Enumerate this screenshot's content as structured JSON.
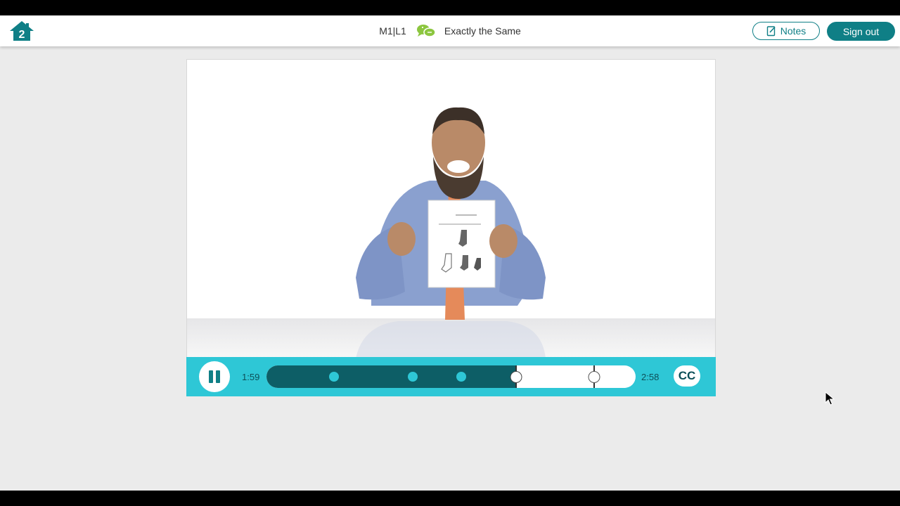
{
  "header": {
    "lesson_code": "M1|L1",
    "lesson_title": "Exactly the Same",
    "home_icon_text": "2",
    "notes_label": "Notes",
    "signout_label": "Sign out"
  },
  "player": {
    "current_time": "1:59",
    "total_time": "2:58",
    "cc_label": "CC",
    "progress_fraction": 0.676,
    "chapter_markers_fraction": [
      0.182,
      0.397,
      0.527
    ],
    "upcoming_markers_fraction": [
      0.887
    ]
  },
  "colors": {
    "brand_teal": "#0f7f86",
    "control_bar": "#2ec7d6",
    "progress_fill": "#0d5e66",
    "chat_icon_green": "#8cc63f"
  },
  "icons": [
    "home-icon",
    "chat-bubbles-icon",
    "notes-icon",
    "pause-icon",
    "closed-captions-icon",
    "mouse-cursor-icon"
  ]
}
